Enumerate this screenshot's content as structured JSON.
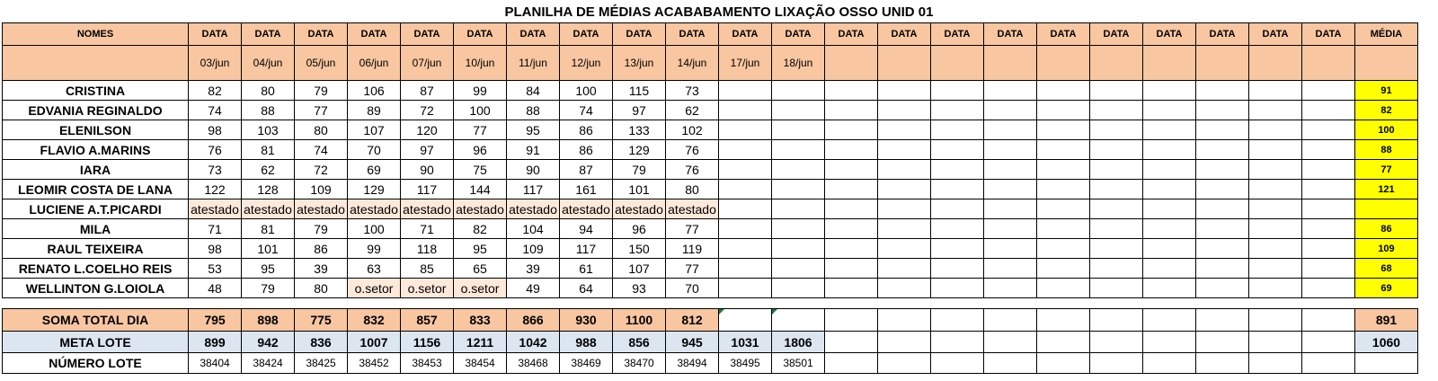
{
  "title": "PLANILHA DE MÉDIAS ACABABAMENTO LIXAÇÃO OSSO UNID 01",
  "header": {
    "names_label": "NOMES",
    "date_label": "DATA",
    "avg_label": "MÉDIA",
    "date_column_count": 22,
    "dates": [
      "03/jun",
      "04/jun",
      "05/jun",
      "06/jun",
      "07/jun",
      "10/jun",
      "11/jun",
      "12/jun",
      "13/jun",
      "14/jun",
      "17/jun",
      "18/jun"
    ]
  },
  "rows": [
    {
      "name": "CRISTINA",
      "values": [
        "82",
        "80",
        "79",
        "106",
        "87",
        "99",
        "84",
        "100",
        "115",
        "73"
      ],
      "avg": "91"
    },
    {
      "name": "EDVANIA REGINALDO",
      "values": [
        "74",
        "88",
        "77",
        "89",
        "72",
        "100",
        "88",
        "74",
        "97",
        "62"
      ],
      "avg": "82"
    },
    {
      "name": "ELENILSON",
      "values": [
        "98",
        "103",
        "80",
        "107",
        "120",
        "77",
        "95",
        "86",
        "133",
        "102"
      ],
      "avg": "100"
    },
    {
      "name": "FLAVIO A.MARINS",
      "values": [
        "76",
        "81",
        "74",
        "70",
        "97",
        "96",
        "91",
        "86",
        "129",
        "76"
      ],
      "avg": "88"
    },
    {
      "name": "IARA",
      "values": [
        "73",
        "62",
        "72",
        "69",
        "90",
        "75",
        "90",
        "87",
        "79",
        "76"
      ],
      "avg": "77"
    },
    {
      "name": "LEOMIR COSTA DE LANA",
      "values": [
        "122",
        "128",
        "109",
        "129",
        "117",
        "144",
        "117",
        "161",
        "101",
        "80"
      ],
      "avg": "121"
    },
    {
      "name": "LUCIENE A.T.PICARDI",
      "values": [
        "atestado",
        "atestado",
        "atestado",
        "atestado",
        "atestado",
        "atestado",
        "atestado",
        "atestado",
        "atestado",
        "atestado"
      ],
      "avg": "",
      "highlight": [
        0,
        1,
        2,
        3,
        4,
        5,
        6,
        7,
        8,
        9
      ]
    },
    {
      "name": "MILA",
      "values": [
        "71",
        "81",
        "79",
        "100",
        "71",
        "82",
        "104",
        "94",
        "96",
        "77"
      ],
      "avg": "86"
    },
    {
      "name": "RAUL TEIXEIRA",
      "values": [
        "98",
        "101",
        "86",
        "99",
        "118",
        "95",
        "109",
        "117",
        "150",
        "119"
      ],
      "avg": "109"
    },
    {
      "name": "RENATO L.COELHO REIS",
      "values": [
        "53",
        "95",
        "39",
        "63",
        "85",
        "65",
        "39",
        "61",
        "107",
        "77"
      ],
      "avg": "68"
    },
    {
      "name": "WELLINTON G.LOIOLA",
      "values": [
        "48",
        "79",
        "80",
        "o.setor",
        "o.setor",
        "o.setor",
        "49",
        "64",
        "93",
        "70"
      ],
      "avg": "69",
      "highlight": [
        3,
        4,
        5
      ]
    }
  ],
  "soma": {
    "label": "SOMA TOTAL DIA",
    "values": [
      "795",
      "898",
      "775",
      "832",
      "857",
      "833",
      "866",
      "930",
      "1100",
      "812"
    ],
    "avg": "891"
  },
  "meta": {
    "label": "META LOTE",
    "values": [
      "899",
      "942",
      "836",
      "1007",
      "1156",
      "1211",
      "1042",
      "988",
      "856",
      "945",
      "1031",
      "1806"
    ],
    "avg": "1060"
  },
  "lote": {
    "label": "NÚMERO LOTE",
    "values": [
      "38404",
      "38424",
      "38425",
      "38452",
      "38453",
      "38454",
      "38468",
      "38469",
      "38470",
      "38494",
      "38495",
      "38501"
    ]
  },
  "colors": {
    "header_fill": "#f8c6a0",
    "average_fill": "#ffff00",
    "meta_fill": "#dce6f1",
    "note_fill": "#fde9d9",
    "flag": "#1e7b34"
  }
}
